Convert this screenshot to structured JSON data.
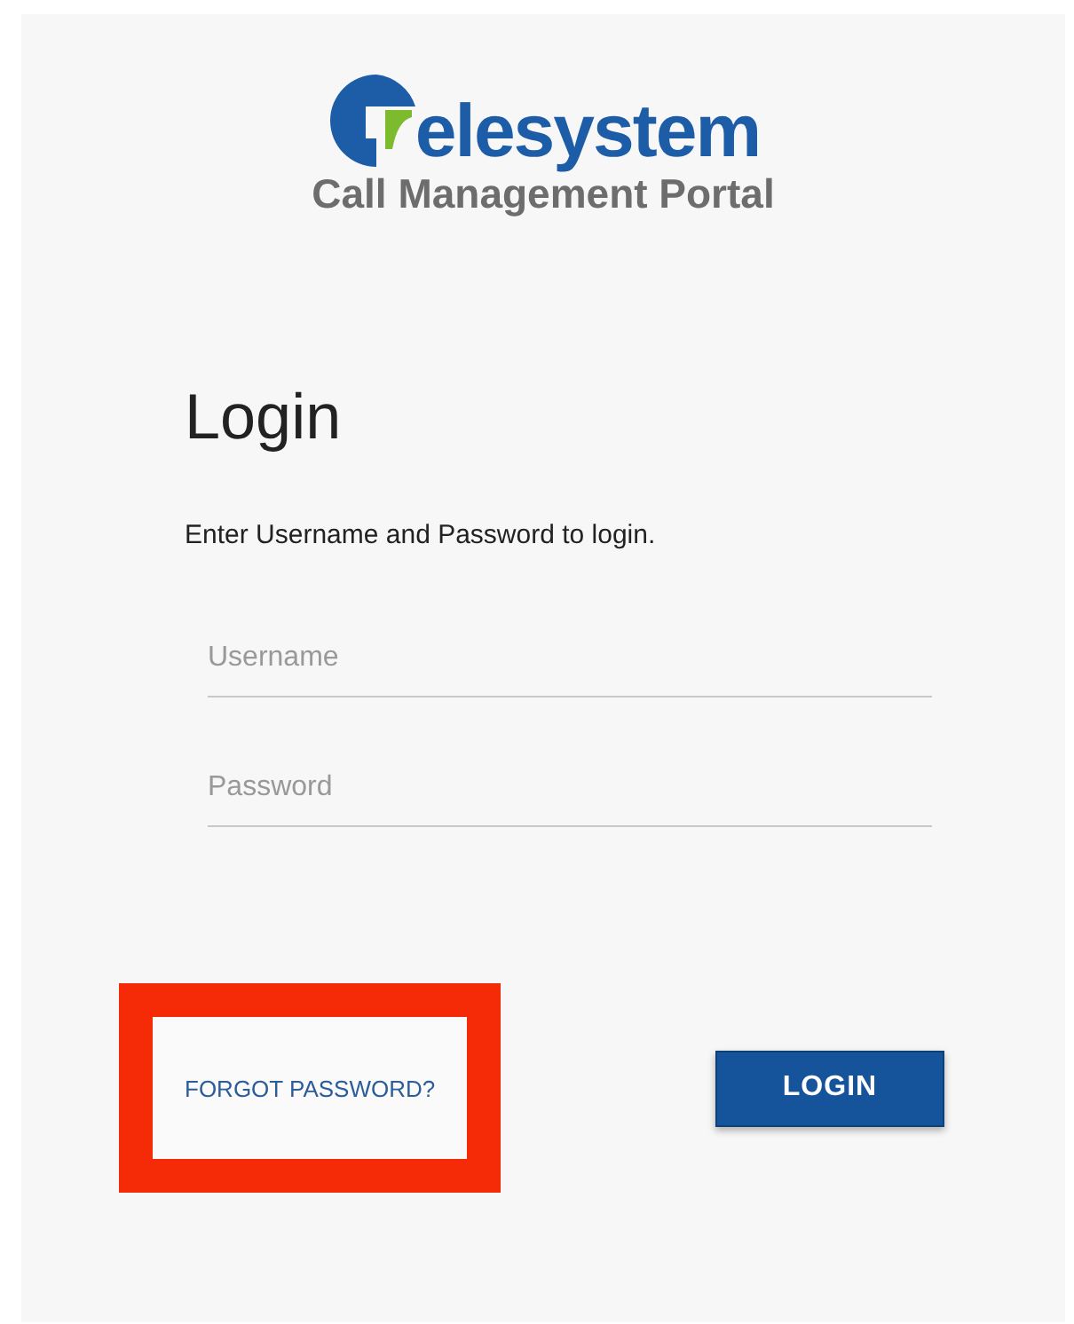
{
  "logo": {
    "wordmark": "elesystem",
    "subtitle": "Call Management Portal"
  },
  "login": {
    "title": "Login",
    "instruction": "Enter Username and Password to login.",
    "fields": [
      {
        "placeholder": "Username"
      },
      {
        "placeholder": "Password"
      }
    ],
    "forgot_link": "FORGOT PASSWORD?",
    "highlighted": true,
    "button": "LOGIN"
  }
}
